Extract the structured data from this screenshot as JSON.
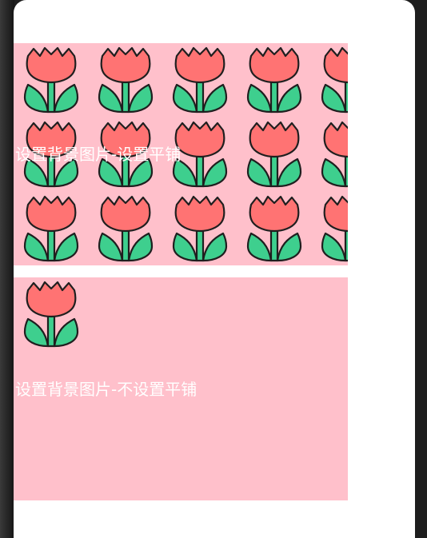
{
  "panels": {
    "repeat": {
      "label": "设置背景图片-设置平铺",
      "background_color": "#ffc0cb",
      "image": "tulip-icon",
      "repeat": true
    },
    "no_repeat": {
      "label": "设置背景图片-不设置平铺",
      "background_color": "#ffc0cb",
      "image": "tulip-icon",
      "repeat": false
    }
  },
  "colors": {
    "tulip_flower": "#ff7373",
    "tulip_leaf": "#3ecf8e",
    "outline": "#1f1f1f",
    "label_text": "#ffffff"
  }
}
